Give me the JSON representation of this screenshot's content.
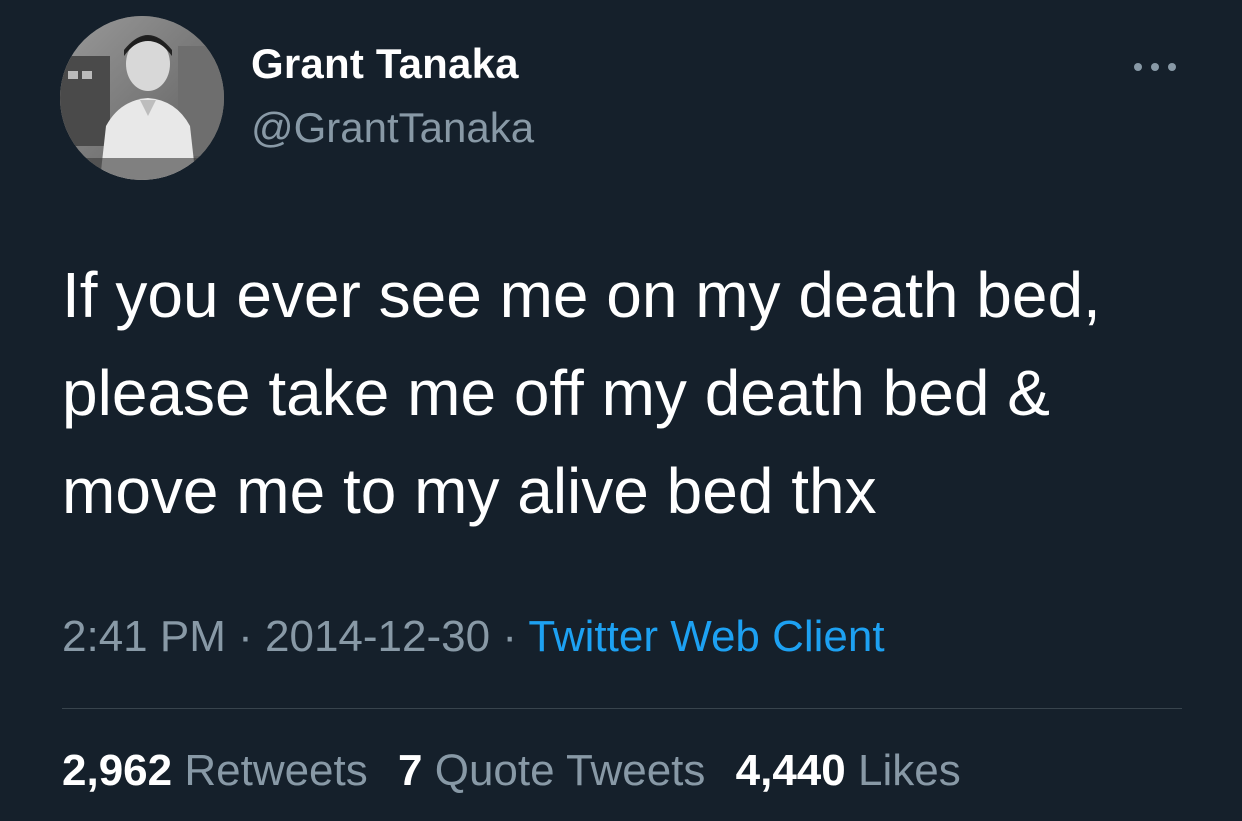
{
  "colors": {
    "background": "#15202b",
    "primary_text": "#ffffff",
    "secondary_text": "#8899a6",
    "link": "#1da1f2",
    "divider": "#38444d"
  },
  "author": {
    "display_name": "Grant Tanaka",
    "handle": "@GrantTanaka",
    "avatar_icon": "profile-photo"
  },
  "more_icon": "more-horizontal-icon",
  "tweet": {
    "lines": [
      "If you ever see me on my death bed,",
      "please take me off my death bed &",
      "move me to my alive bed thx"
    ]
  },
  "meta": {
    "time": "2:41 PM",
    "separator": "·",
    "date": "2014-12-30",
    "source": "Twitter Web Client"
  },
  "stats": {
    "retweets_count": "2,962",
    "retweets_label": "Retweets",
    "quotes_count": "7",
    "quotes_label": "Quote Tweets",
    "likes_count": "4,440",
    "likes_label": "Likes"
  }
}
